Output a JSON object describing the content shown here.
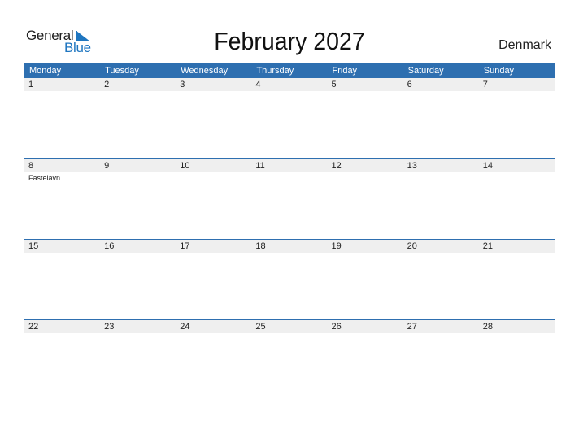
{
  "logo": {
    "word1": "General",
    "word2": "Blue"
  },
  "title": "February 2027",
  "country": "Denmark",
  "weekdays": [
    "Monday",
    "Tuesday",
    "Wednesday",
    "Thursday",
    "Friday",
    "Saturday",
    "Sunday"
  ],
  "weeks": [
    {
      "days": [
        "1",
        "2",
        "3",
        "4",
        "5",
        "6",
        "7"
      ],
      "events": [
        "",
        "",
        "",
        "",
        "",
        "",
        ""
      ]
    },
    {
      "days": [
        "8",
        "9",
        "10",
        "11",
        "12",
        "13",
        "14"
      ],
      "events": [
        "Fastelavn",
        "",
        "",
        "",
        "",
        "",
        ""
      ]
    },
    {
      "days": [
        "15",
        "16",
        "17",
        "18",
        "19",
        "20",
        "21"
      ],
      "events": [
        "",
        "",
        "",
        "",
        "",
        "",
        ""
      ]
    },
    {
      "days": [
        "22",
        "23",
        "24",
        "25",
        "26",
        "27",
        "28"
      ],
      "events": [
        "",
        "",
        "",
        "",
        "",
        "",
        ""
      ]
    }
  ],
  "colors": {
    "accent": "#2e6fb0",
    "logo_blue": "#1f76c0",
    "date_bg": "#efefef"
  }
}
